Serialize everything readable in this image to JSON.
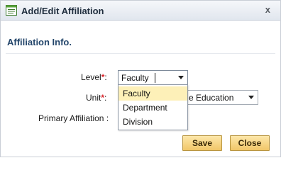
{
  "window": {
    "title": "Add/Edit Affiliation",
    "close_glyph": "x"
  },
  "section": {
    "title": "Affiliation Info."
  },
  "form": {
    "level": {
      "label": "Level",
      "required_mark": "*",
      "colon": ":",
      "value": "Faculty"
    },
    "unit": {
      "label": "Unit",
      "required_mark": "*",
      "colon": ":",
      "value_visible": "e Education"
    },
    "primary": {
      "label": "Primary Affiliation :"
    }
  },
  "dropdown": {
    "options": [
      {
        "label": "Faculty",
        "selected": true
      },
      {
        "label": "Department",
        "selected": false
      },
      {
        "label": "Division",
        "selected": false
      }
    ]
  },
  "buttons": {
    "save_label": "Save",
    "close_label": "Close"
  },
  "icons": {
    "title_icon": "form-list-icon",
    "dropdown_caret": "chevron-down-icon"
  },
  "colors": {
    "selected_option": "#fdf0b8",
    "required": "#d8232a",
    "button": "#f1c668"
  }
}
